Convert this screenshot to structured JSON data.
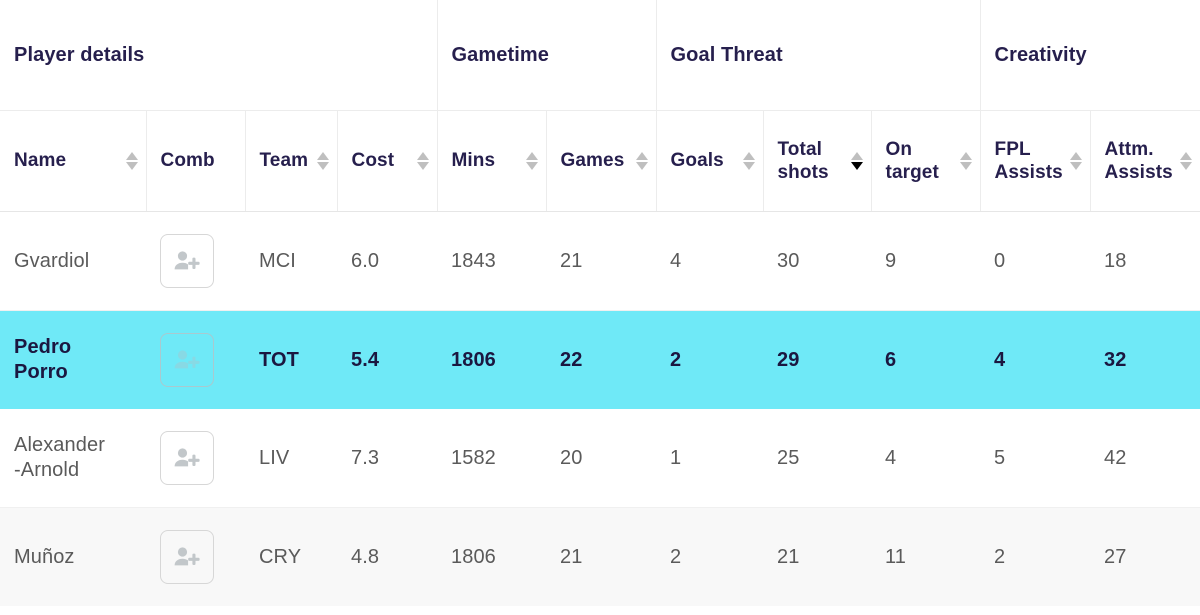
{
  "table": {
    "groups": [
      {
        "label": "Player details",
        "span": 4
      },
      {
        "label": "Gametime",
        "span": 2
      },
      {
        "label": "Goal Threat",
        "span": 3
      },
      {
        "label": "Creativity",
        "span": 2
      }
    ],
    "columns": [
      {
        "key": "name",
        "label": "Name",
        "sortable": true,
        "sort": "none"
      },
      {
        "key": "comb",
        "label": "Comb",
        "sortable": false,
        "sort": "none"
      },
      {
        "key": "team",
        "label": "Team",
        "sortable": true,
        "sort": "none"
      },
      {
        "key": "cost",
        "label": "Cost",
        "sortable": true,
        "sort": "none"
      },
      {
        "key": "mins",
        "label": "Mins",
        "sortable": true,
        "sort": "none"
      },
      {
        "key": "games",
        "label": "Games",
        "sortable": true,
        "sort": "none"
      },
      {
        "key": "goals",
        "label": "Goals",
        "sortable": true,
        "sort": "none"
      },
      {
        "key": "total_shots",
        "label": "Total shots",
        "sortable": true,
        "sort": "desc"
      },
      {
        "key": "on_target",
        "label": "On target",
        "sortable": true,
        "sort": "none"
      },
      {
        "key": "fpl_assists",
        "label": "FPL Assists",
        "sortable": true,
        "sort": "none"
      },
      {
        "key": "attm_assists",
        "label": "Attm. Assists",
        "sortable": true,
        "sort": "none"
      }
    ],
    "add_button_icon": "add-person-icon",
    "rows": [
      {
        "state": "default",
        "name": "Gvardiol",
        "team": "MCI",
        "cost": "6.0",
        "mins": "1843",
        "games": "21",
        "goals": "4",
        "total_shots": "30",
        "on_target": "9",
        "fpl_assists": "0",
        "attm_assists": "18"
      },
      {
        "state": "highlight",
        "name": "Pedro\nPorro",
        "team": "TOT",
        "cost": "5.4",
        "mins": "1806",
        "games": "22",
        "goals": "2",
        "total_shots": "29",
        "on_target": "6",
        "fpl_assists": "4",
        "attm_assists": "32"
      },
      {
        "state": "default",
        "name": "Alexander\n-Arnold",
        "team": "LIV",
        "cost": "7.3",
        "mins": "1582",
        "games": "20",
        "goals": "1",
        "total_shots": "25",
        "on_target": "4",
        "fpl_assists": "5",
        "attm_assists": "42"
      },
      {
        "state": "alt",
        "name": "Muñoz",
        "team": "CRY",
        "cost": "4.8",
        "mins": "1806",
        "games": "21",
        "goals": "2",
        "total_shots": "21",
        "on_target": "11",
        "fpl_assists": "2",
        "attm_assists": "27"
      }
    ]
  },
  "colors": {
    "highlight_row": "#6FE9F7",
    "alt_row": "#F8F8F8",
    "header_text": "#261F4D",
    "body_text": "#5A5A5A",
    "sorter_inactive": "#BFBFBF",
    "sorter_active": "#000000",
    "border": "#ECECEC"
  }
}
